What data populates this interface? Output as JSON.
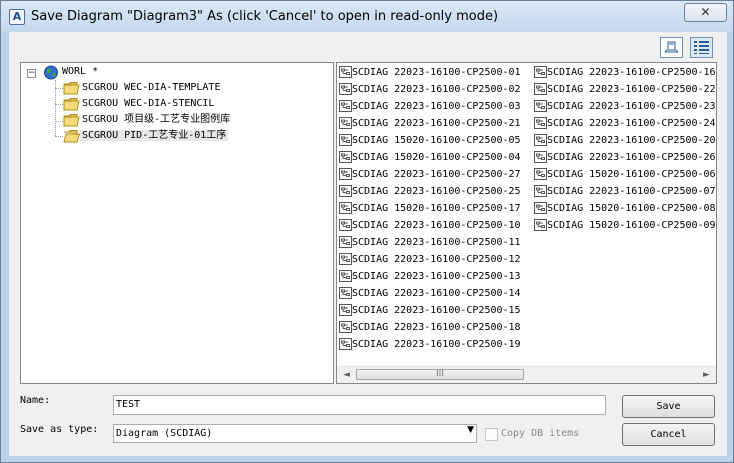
{
  "window": {
    "title": "Save Diagram \"Diagram3\" As   (click 'Cancel' to open in read-only mode)",
    "app_icon": "A",
    "close_label": "✕"
  },
  "toolbar": {
    "buttons": [
      {
        "icon": "list-view-icon",
        "selected": false
      },
      {
        "icon": "details-view-icon",
        "selected": true
      }
    ]
  },
  "tree": {
    "root": {
      "label": "WORL *",
      "icon": "globe-icon",
      "expander": "−"
    },
    "children": [
      {
        "label": "SCGROU WEC-DIA-TEMPLATE",
        "icon": "folder-icon"
      },
      {
        "label": "SCGROU WEC-DIA-STENCIL",
        "icon": "folder-icon"
      },
      {
        "label": "SCGROU 项目级-工艺专业图例库",
        "icon": "folder-icon"
      },
      {
        "label": "SCGROU PID-工艺专业-01工序",
        "icon": "folder-icon",
        "selected": true
      }
    ]
  },
  "files": {
    "column1": [
      "SCDIAG 22023-16100-CP2500-01",
      "SCDIAG 22023-16100-CP2500-02",
      "SCDIAG 22023-16100-CP2500-03",
      "SCDIAG 22023-16100-CP2500-21",
      "SCDIAG 15020-16100-CP2500-05",
      "SCDIAG 15020-16100-CP2500-04",
      "SCDIAG 22023-16100-CP2500-27",
      "SCDIAG 22023-16100-CP2500-25",
      "SCDIAG 15020-16100-CP2500-17",
      "SCDIAG 22023-16100-CP2500-10",
      "SCDIAG 22023-16100-CP2500-11",
      "SCDIAG 22023-16100-CP2500-12",
      "SCDIAG 22023-16100-CP2500-13",
      "SCDIAG 22023-16100-CP2500-14",
      "SCDIAG 22023-16100-CP2500-15",
      "SCDIAG 22023-16100-CP2500-18",
      "SCDIAG 22023-16100-CP2500-19"
    ],
    "column2": [
      "SCDIAG 22023-16100-CP2500-16",
      "SCDIAG 22023-16100-CP2500-22",
      "SCDIAG 22023-16100-CP2500-23",
      "SCDIAG 22023-16100-CP2500-24",
      "SCDIAG 22023-16100-CP2500-20",
      "SCDIAG 22023-16100-CP2500-26",
      "SCDIAG 15020-16100-CP2500-06",
      "SCDIAG 22023-16100-CP2500-07",
      "SCDIAG 15020-16100-CP2500-08",
      "SCDIAG 15020-16100-CP2500-09"
    ]
  },
  "scrollbar": {
    "left": "◄",
    "right": "►",
    "grip": "III"
  },
  "form": {
    "name_label": "Name:",
    "name_value": "TEST",
    "type_label": "Save as type:",
    "type_value": "Diagram  (SCDIAG)",
    "type_dropdown": "▼",
    "copy_label": "Copy DB items",
    "save_label": "Save",
    "cancel_label": "Cancel"
  }
}
